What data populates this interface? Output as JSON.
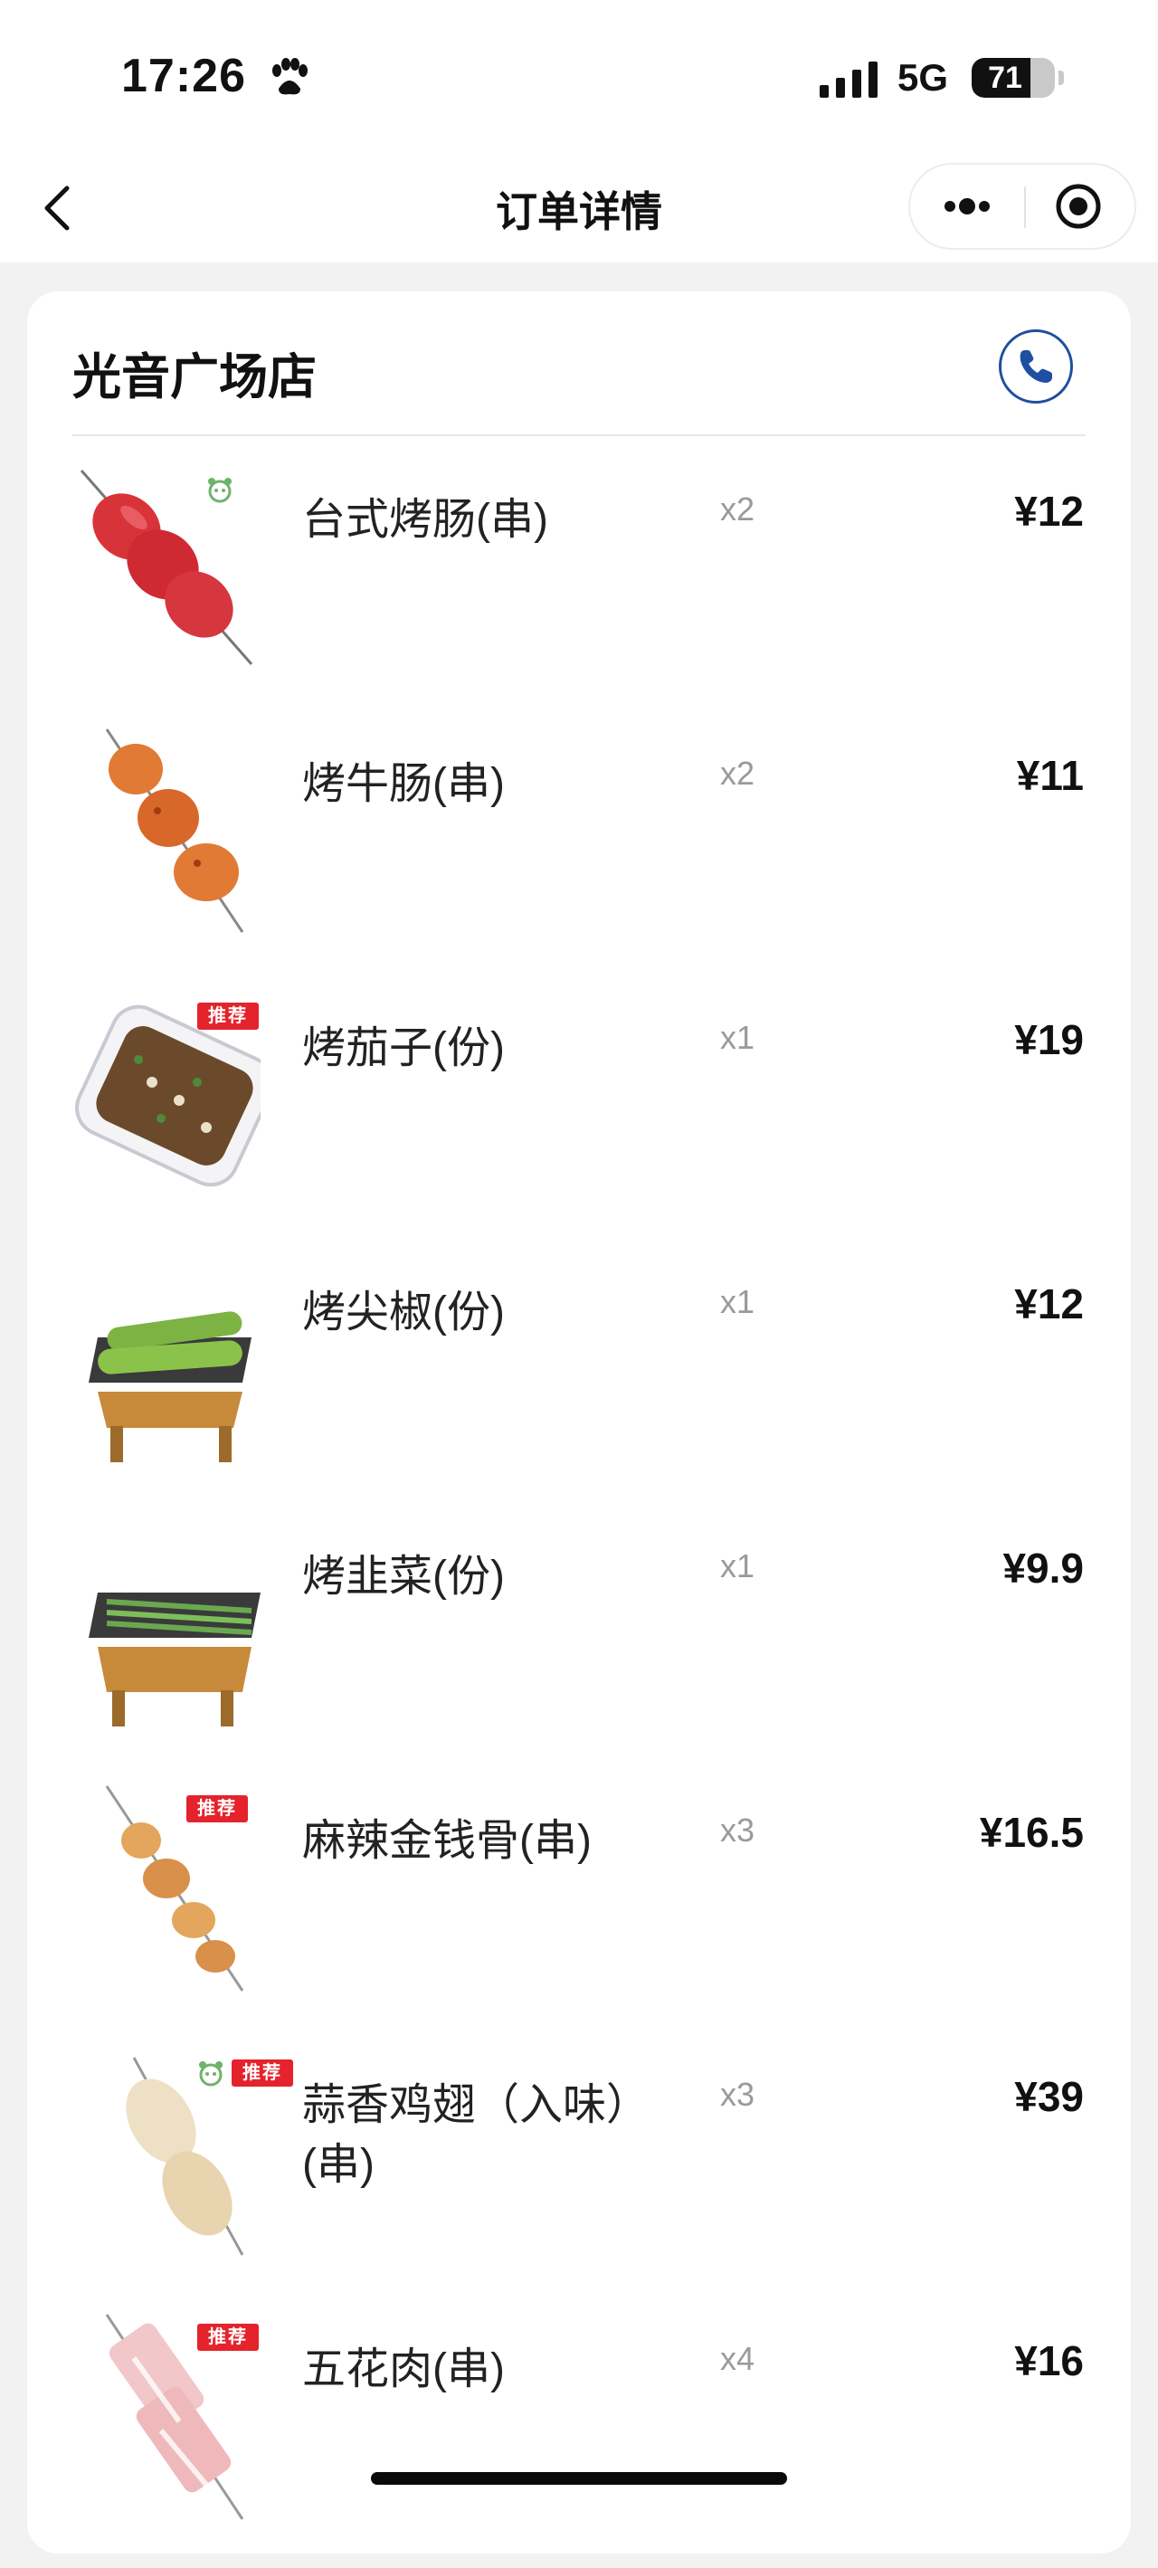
{
  "status_bar": {
    "time": "17:26",
    "network": "5G",
    "battery": "71",
    "battery_level": 0.71
  },
  "nav": {
    "title": "订单详情"
  },
  "store": {
    "name": "光音广场店"
  },
  "badge_text": "推荐",
  "items": [
    {
      "name": "台式烤肠(串)",
      "qty": "x2",
      "price": "¥12",
      "thumb": "sausage-skewer",
      "badge": false,
      "mascot": true
    },
    {
      "name": "烤牛肠(串)",
      "qty": "x2",
      "price": "¥11",
      "thumb": "beef-intestine-skewer",
      "badge": false,
      "mascot": false
    },
    {
      "name": "烤茄子(份)",
      "qty": "x1",
      "price": "¥19",
      "thumb": "eggplant-tray",
      "badge": true,
      "mascot": false
    },
    {
      "name": "烤尖椒(份)",
      "qty": "x1",
      "price": "¥12",
      "thumb": "pepper-grill",
      "badge": false,
      "mascot": false
    },
    {
      "name": "烤韭菜(份)",
      "qty": "x1",
      "price": "¥9.9",
      "thumb": "chive-grill",
      "badge": false,
      "mascot": false
    },
    {
      "name": "麻辣金钱骨(串)",
      "qty": "x3",
      "price": "¥16.5",
      "thumb": "spicy-bone-skewer",
      "badge": true,
      "mascot": false
    },
    {
      "name": "蒜香鸡翅（入味）(串)",
      "qty": "x3",
      "price": "¥39",
      "thumb": "chicken-wing-skewer",
      "badge": true,
      "mascot": true
    },
    {
      "name": "五花肉(串)",
      "qty": "x4",
      "price": "¥16",
      "thumb": "pork-belly-skewer",
      "badge": true,
      "mascot": false
    }
  ]
}
